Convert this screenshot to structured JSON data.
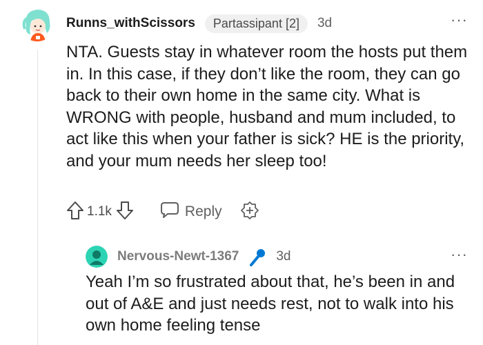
{
  "comment": {
    "username": "Runns_withScissors",
    "flair": "Partassipant [2]",
    "age": "3d",
    "more_icon": "more-dots-icon",
    "body": "NTA. Guests stay in whatever room the hosts put them in. In this case, if they don’t like the room, they can go back to their own home in the same city. What is WRONG with people, husband and mum included, to act like this when your father is sick? HE is the priority, and your mum needs her sleep too!",
    "actions": {
      "vote_count": "1.1k",
      "reply_label": "Reply",
      "upvote_icon": "upvote-arrow-icon",
      "downvote_icon": "downvote-arrow-icon",
      "reply_icon": "chat-bubble-icon",
      "award_icon": "award-icon"
    }
  },
  "reply": {
    "username": "Nervous-Newt-1367",
    "age": "3d",
    "badge_icon": "microphone-icon",
    "badge_color": "#0079d3",
    "body": "Yeah I’m so frustrated about that, he’s been in and out of A&E and just needs rest, not to walk into his own home feeling tense"
  },
  "colors": {
    "text": "#1c1c1c",
    "meta": "#5f5f5f",
    "flair_bg": "#f0f0f0",
    "reply_username": "#7c7c7c",
    "avatar_reply_bg": "#2dd4b4"
  }
}
